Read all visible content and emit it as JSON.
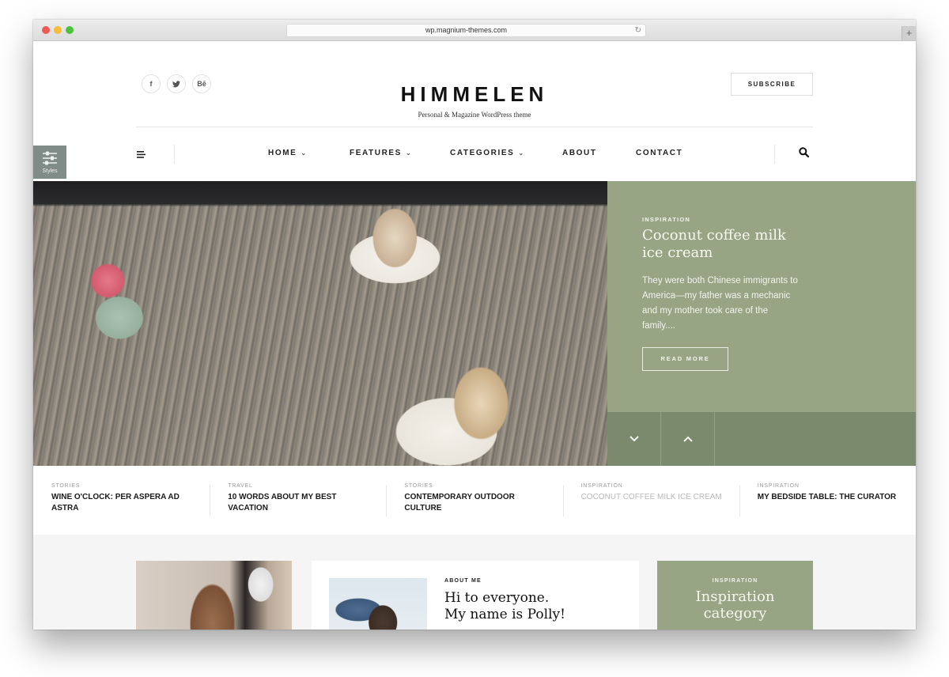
{
  "browser": {
    "url": "wp.magnium-themes.com",
    "new_tab_label": "+"
  },
  "header": {
    "social": [
      {
        "icon": "facebook-icon",
        "glyph": "f"
      },
      {
        "icon": "twitter-icon",
        "glyph": "t"
      },
      {
        "icon": "behance-icon",
        "glyph": "Bē"
      }
    ],
    "logo": "HIMMELEN",
    "tagline": "Personal & Magazine WordPress theme",
    "subscribe_label": "SUBSCRIBE"
  },
  "nav": {
    "styles_label": "Styles",
    "items": [
      {
        "label": "HOME",
        "has_dropdown": true
      },
      {
        "label": "FEATURES",
        "has_dropdown": true
      },
      {
        "label": "CATEGORIES",
        "has_dropdown": true
      },
      {
        "label": "ABOUT",
        "has_dropdown": false
      },
      {
        "label": "CONTACT",
        "has_dropdown": false
      }
    ],
    "dropdown_glyph": "⌄"
  },
  "hero": {
    "category": "INSPIRATION",
    "title": "Coconut coffee milk ice cream",
    "excerpt": "They were both Chinese immigrants to America—my father was a mechanic and my mother took care of the family....",
    "read_more_label": "READ MORE"
  },
  "strip": [
    {
      "category": "STORIES",
      "title": "WINE O'CLOCK: PER ASPERA AD ASTRA",
      "active": false
    },
    {
      "category": "TRAVEL",
      "title": "10 WORDS ABOUT MY BEST VACATION",
      "active": false
    },
    {
      "category": "STORIES",
      "title": "CONTEMPORARY OUTDOOR CULTURE",
      "active": false
    },
    {
      "category": "INSPIRATION",
      "title": "COCONUT COFFEE MILK ICE CREAM",
      "active": true
    },
    {
      "category": "INSPIRATION",
      "title": "MY BEDSIDE TABLE: THE CURATOR",
      "active": false
    }
  ],
  "about": {
    "label": "ABOUT ME",
    "title_line1": "Hi to everyone.",
    "title_line2": "My name is Polly!"
  },
  "inspiration_card": {
    "category": "INSPIRATION",
    "title_line1": "Inspiration",
    "title_line2": "category"
  },
  "colors": {
    "accent_green": "#97a585",
    "accent_green_dark": "#7b8a6c",
    "styles_tab": "#7f8c88"
  }
}
